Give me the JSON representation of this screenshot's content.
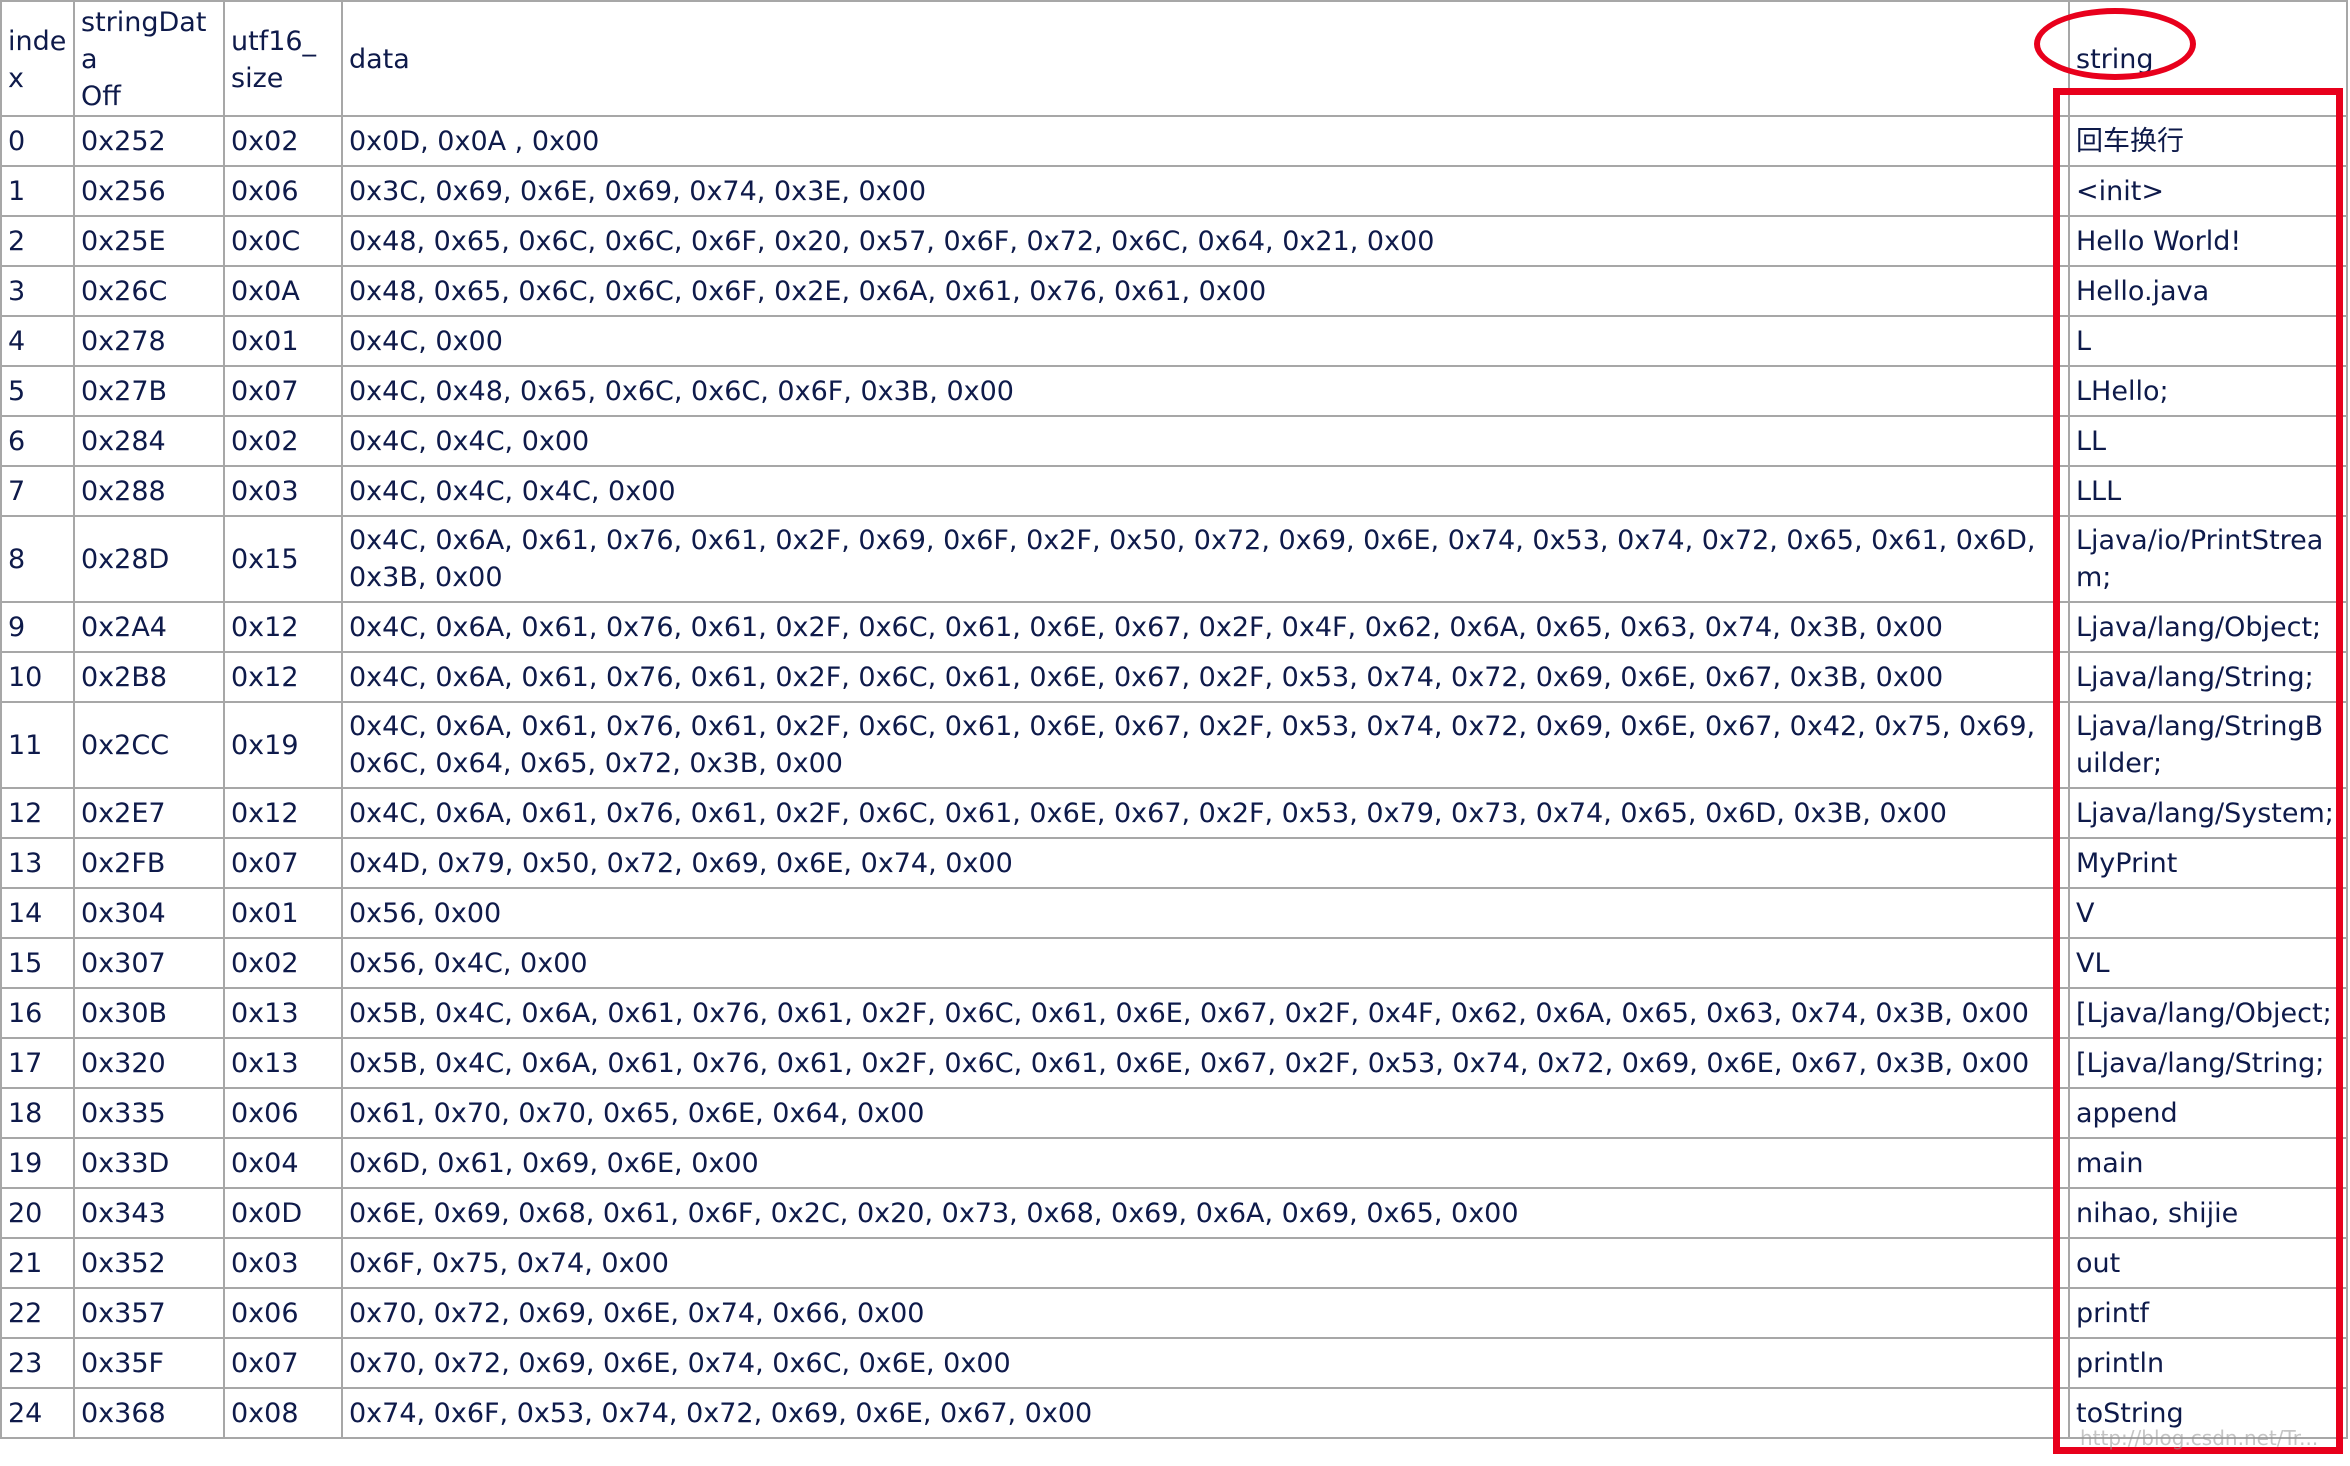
{
  "headers": {
    "index": "index",
    "string_data_off": "stringData\nOff",
    "utf16_size": "utf16_\nsize",
    "data": "data",
    "string": "string"
  },
  "rows": [
    {
      "index": "0",
      "off": "0x252",
      "size": "0x02",
      "data": "0x0D, 0x0A , 0x00",
      "string": "回车换行"
    },
    {
      "index": "1",
      "off": "0x256",
      "size": "0x06",
      "data": "0x3C, 0x69, 0x6E, 0x69, 0x74, 0x3E, 0x00",
      "string": "<init>"
    },
    {
      "index": "2",
      "off": "0x25E",
      "size": "0x0C",
      "data": "0x48, 0x65, 0x6C, 0x6C, 0x6F, 0x20, 0x57, 0x6F, 0x72, 0x6C, 0x64, 0x21, 0x00",
      "string": "Hello World!"
    },
    {
      "index": "3",
      "off": "0x26C",
      "size": "0x0A",
      "data": "0x48, 0x65, 0x6C, 0x6C, 0x6F, 0x2E, 0x6A, 0x61, 0x76, 0x61, 0x00",
      "string": "Hello.java"
    },
    {
      "index": "4",
      "off": "0x278",
      "size": "0x01",
      "data": "0x4C, 0x00",
      "string": "L"
    },
    {
      "index": "5",
      "off": "0x27B",
      "size": "0x07",
      "data": "0x4C, 0x48, 0x65, 0x6C, 0x6C, 0x6F, 0x3B, 0x00",
      "string": "LHello;"
    },
    {
      "index": "6",
      "off": "0x284",
      "size": "0x02",
      "data": "0x4C, 0x4C, 0x00",
      "string": "LL"
    },
    {
      "index": "7",
      "off": "0x288",
      "size": "0x03",
      "data": "0x4C, 0x4C, 0x4C, 0x00",
      "string": "LLL"
    },
    {
      "index": "8",
      "off": "0x28D",
      "size": "0x15",
      "data": "0x4C, 0x6A, 0x61, 0x76, 0x61, 0x2F, 0x69, 0x6F, 0x2F, 0x50, 0x72, 0x69, 0x6E, 0x74, 0x53, 0x74, 0x72, 0x65, 0x61, 0x6D, 0x3B, 0x00",
      "string": "Ljava/io/PrintStream;"
    },
    {
      "index": "9",
      "off": "0x2A4",
      "size": "0x12",
      "data": "0x4C, 0x6A, 0x61, 0x76, 0x61, 0x2F, 0x6C, 0x61, 0x6E, 0x67, 0x2F, 0x4F, 0x62, 0x6A, 0x65, 0x63, 0x74, 0x3B, 0x00",
      "string": "Ljava/lang/Object;"
    },
    {
      "index": "10",
      "off": "0x2B8",
      "size": "0x12",
      "data": "0x4C, 0x6A, 0x61, 0x76, 0x61, 0x2F, 0x6C, 0x61, 0x6E, 0x67, 0x2F, 0x53, 0x74, 0x72, 0x69, 0x6E, 0x67, 0x3B, 0x00",
      "string": "Ljava/lang/String;"
    },
    {
      "index": "11",
      "off": "0x2CC",
      "size": "0x19",
      "data": "0x4C, 0x6A, 0x61, 0x76, 0x61, 0x2F, 0x6C, 0x61, 0x6E, 0x67, 0x2F, 0x53, 0x74, 0x72, 0x69, 0x6E, 0x67, 0x42, 0x75, 0x69, 0x6C, 0x64, 0x65, 0x72, 0x3B, 0x00",
      "string": "Ljava/lang/StringBuilder;"
    },
    {
      "index": "12",
      "off": "0x2E7",
      "size": "0x12",
      "data": "0x4C, 0x6A, 0x61, 0x76, 0x61, 0x2F, 0x6C, 0x61, 0x6E, 0x67, 0x2F, 0x53, 0x79, 0x73, 0x74, 0x65, 0x6D, 0x3B, 0x00",
      "string": "Ljava/lang/System;"
    },
    {
      "index": "13",
      "off": "0x2FB",
      "size": "0x07",
      "data": "0x4D, 0x79, 0x50, 0x72, 0x69, 0x6E, 0x74, 0x00",
      "string": "MyPrint"
    },
    {
      "index": "14",
      "off": "0x304",
      "size": "0x01",
      "data": "0x56, 0x00",
      "string": "V"
    },
    {
      "index": "15",
      "off": "0x307",
      "size": "0x02",
      "data": "0x56, 0x4C, 0x00",
      "string": "VL"
    },
    {
      "index": "16",
      "off": "0x30B",
      "size": "0x13",
      "data": "0x5B, 0x4C, 0x6A, 0x61, 0x76, 0x61, 0x2F, 0x6C, 0x61, 0x6E, 0x67, 0x2F, 0x4F, 0x62, 0x6A, 0x65, 0x63, 0x74, 0x3B, 0x00",
      "string": "[Ljava/lang/Object;"
    },
    {
      "index": "17",
      "off": "0x320",
      "size": "0x13",
      "data": "0x5B, 0x4C, 0x6A, 0x61, 0x76, 0x61, 0x2F, 0x6C, 0x61, 0x6E, 0x67, 0x2F, 0x53, 0x74, 0x72, 0x69, 0x6E, 0x67, 0x3B, 0x00",
      "string": "[Ljava/lang/String;"
    },
    {
      "index": "18",
      "off": "0x335",
      "size": "0x06",
      "data": "0x61, 0x70, 0x70, 0x65, 0x6E, 0x64, 0x00",
      "string": "append"
    },
    {
      "index": "19",
      "off": "0x33D",
      "size": "0x04",
      "data": "0x6D, 0x61, 0x69, 0x6E, 0x00",
      "string": "main"
    },
    {
      "index": "20",
      "off": "0x343",
      "size": "0x0D",
      "data": "0x6E, 0x69, 0x68, 0x61, 0x6F, 0x2C, 0x20, 0x73, 0x68, 0x69, 0x6A, 0x69, 0x65, 0x00",
      "string": "nihao, shijie"
    },
    {
      "index": "21",
      "off": "0x352",
      "size": "0x03",
      "data": "0x6F, 0x75, 0x74, 0x00",
      "string": "out"
    },
    {
      "index": "22",
      "off": "0x357",
      "size": "0x06",
      "data": "0x70, 0x72, 0x69, 0x6E, 0x74, 0x66, 0x00",
      "string": "printf"
    },
    {
      "index": "23",
      "off": "0x35F",
      "size": "0x07",
      "data": "0x70, 0x72, 0x69, 0x6E, 0x74, 0x6C, 0x6E, 0x00",
      "string": "println"
    },
    {
      "index": "24",
      "off": "0x368",
      "size": "0x08",
      "data": "0x74, 0x6F, 0x53, 0x74, 0x72, 0x69, 0x6E, 0x67, 0x00",
      "string": "toString"
    }
  ],
  "tall_rows": [
    "8",
    "11"
  ],
  "highlight_color": "#e8001c",
  "watermark": "http://blog.csdn.net/Tr..."
}
